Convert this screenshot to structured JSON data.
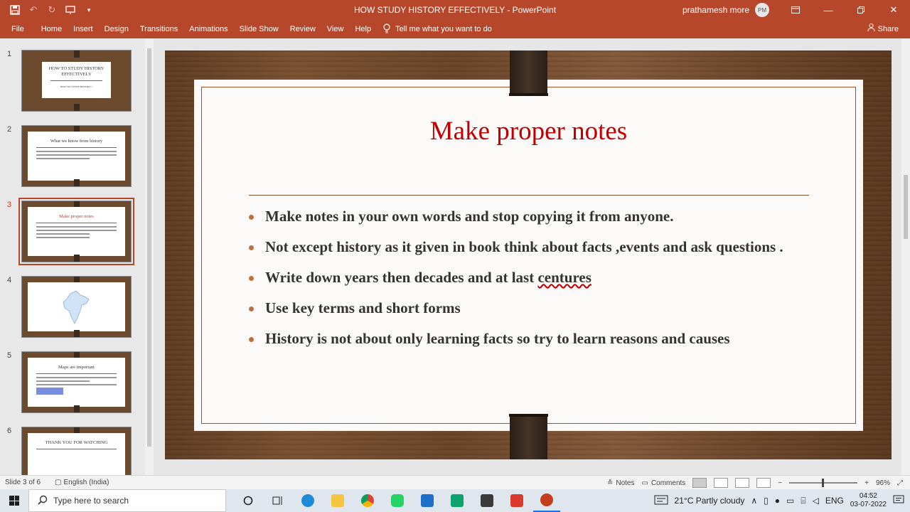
{
  "window": {
    "title": "HOW STUDY HISTORY EFFECTIVELY  -  PowerPoint",
    "user_name": "prathamesh more",
    "user_initials": "PM"
  },
  "ribbon": {
    "tabs": [
      "File",
      "Home",
      "Insert",
      "Design",
      "Transitions",
      "Animations",
      "Slide Show",
      "Review",
      "View",
      "Help"
    ],
    "tell_me": "Tell me what you want to do",
    "share": "Share"
  },
  "thumbnails": [
    {
      "num": "1",
      "title": "HOW TO STUDY HISTORY EFFECTIVELY",
      "subtitle": "HOW WE STUDY HISTORY ?"
    },
    {
      "num": "2",
      "title": "What we know from history"
    },
    {
      "num": "3",
      "title": "Make proper notes"
    },
    {
      "num": "4",
      "title": ""
    },
    {
      "num": "5",
      "title": "Maps are important"
    },
    {
      "num": "6",
      "title": "THANK YOU FOR WATCHING"
    }
  ],
  "slide": {
    "title": "Make proper notes",
    "bullets": [
      "Make notes in your own words and stop copying it from anyone.",
      "Not except history as it given in book think about facts ,events and ask questions .",
      "Write down years then decades and at last ",
      "Use key terms and short forms",
      "History is not about only learning facts so try to learn reasons and causes"
    ],
    "bullet3_underlined": "centures"
  },
  "status": {
    "slide_info": "Slide 3 of 6",
    "language": "English (India)",
    "notes": "Notes",
    "comments": "Comments",
    "zoom": "96%",
    "zoom_level": 0.48
  },
  "taskbar": {
    "search_placeholder": "Type here to search",
    "weather": "21°C  Partly cloudy",
    "lang": "ENG",
    "time": "04:52",
    "date": "03-07-2022"
  },
  "colors": {
    "accent": "#b7472a",
    "slide_title": "#c00000",
    "bullet_dot": "#c0703a"
  }
}
